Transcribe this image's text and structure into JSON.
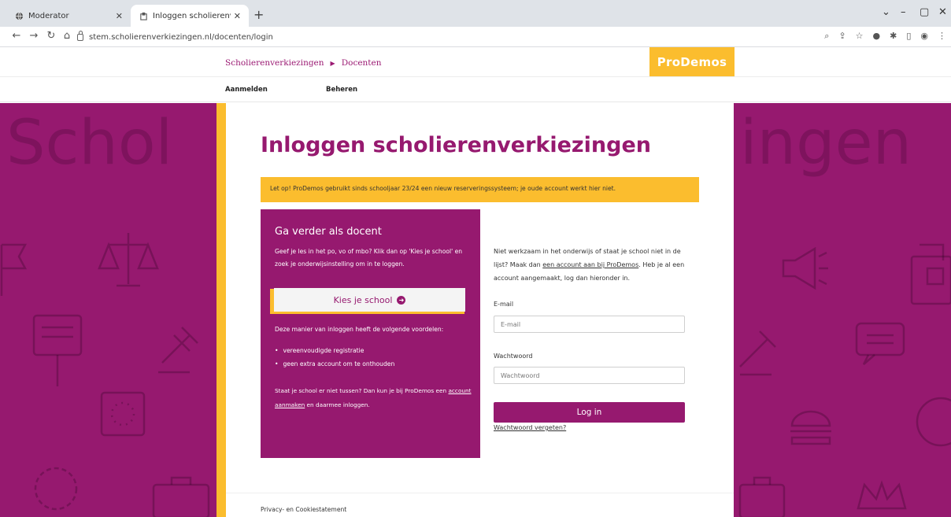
{
  "browser": {
    "tabs": [
      {
        "title": "Moderator",
        "active": false
      },
      {
        "title": "Inloggen scholierenverkiezingen",
        "active": true
      }
    ],
    "url": "stem.scholierenverkiezingen.nl/docenten/login",
    "new_tab_glyph": "+",
    "window_controls": [
      "⌄",
      "–",
      "▢",
      "✕"
    ]
  },
  "header": {
    "breadcrumb": [
      "Scholierenverkiezingen",
      "Docenten"
    ],
    "logo": "ProDemos",
    "nav": [
      "Aanmelden",
      "Beheren"
    ]
  },
  "background": {
    "left_word": "Schol",
    "right_word": "ingen"
  },
  "page": {
    "title": "Inloggen scholierenverkiezingen",
    "notice": "Let op! ProDemos gebruikt sinds schooljaar 23/24 een nieuw reserveringssysteem; je oude account werkt hier niet."
  },
  "teacher_box": {
    "heading": "Ga verder als docent",
    "intro": "Geef je les in het po, vo of mbo? Klik dan op 'Kies je school' en zoek je onderwijsinstelling om in te loggen.",
    "button": "Kies je school",
    "benefits_title": "Deze manier van inloggen heeft de volgende voordelen:",
    "benefits": [
      "vereenvoudigde registratie",
      "geen extra account om te onthouden"
    ],
    "footer_text_1": "Staat je school er niet tussen? Dan kun je bij ProDemos een",
    "footer_link": "account aanmaken",
    "footer_text_2": " en daarmee inloggen."
  },
  "login": {
    "help_1": "Niet werkzaam in het onderwijs of staat je school niet in de lijst? Maak dan ",
    "help_link": "een account aan bij ProDemos",
    "help_2": ". Heb je al een account aangemaakt, log dan hieronder in.",
    "email_label": "E-mail",
    "email_placeholder": "E-mail",
    "password_label": "Wachtwoord",
    "password_placeholder": "Wachtwoord",
    "submit": "Log in",
    "forgot": "Wachtwoord vergeten?"
  },
  "footer": {
    "privacy": "Privacy- en Cookiestatement"
  },
  "colors": {
    "purple": "#96196f",
    "gold": "#fbbd2e"
  }
}
